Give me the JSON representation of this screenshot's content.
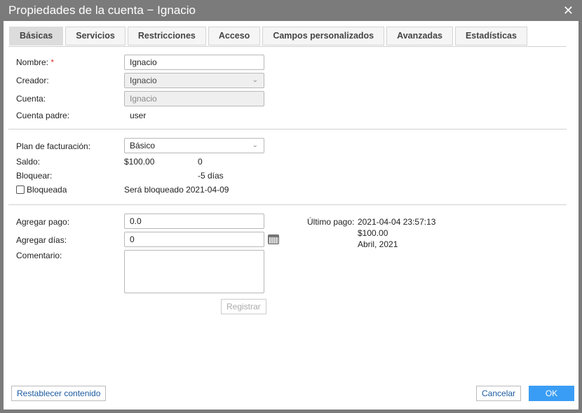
{
  "window": {
    "title": "Propiedades de la cuenta − Ignacio",
    "close": "✕"
  },
  "tabs": [
    "Básicas",
    "Servicios",
    "Restricciones",
    "Acceso",
    "Campos personalizados",
    "Avanzadas",
    "Estadísticas"
  ],
  "form": {
    "nombre_label": "Nombre:",
    "required": "*",
    "nombre_value": "Ignacio",
    "creador_label": "Creador:",
    "creador_value": "Ignacio",
    "cuenta_label": "Cuenta:",
    "cuenta_value": "Ignacio",
    "padre_label": "Cuenta padre:",
    "padre_value": "user",
    "plan_label": "Plan de facturación:",
    "plan_value": "Básico",
    "saldo_label": "Saldo:",
    "saldo_value": "$100.00",
    "saldo_days": "0",
    "bloquear_label": "Bloquear:",
    "bloquear_value": "-5 días",
    "bloqueada_label": "Bloqueada",
    "bloqueada_checked": false,
    "bloqueo_info": "Será bloqueado 2021-04-09",
    "pago_label": "Agregar pago:",
    "pago_value": "0.0",
    "dias_label": "Agregar días:",
    "dias_value": "0",
    "comentario_label": "Comentario:",
    "comentario_value": "",
    "registrar": "Registrar",
    "ultimo_label": "Último pago:",
    "ultimo_fecha": "2021-04-04 23:57:13",
    "ultimo_monto": "$100.00",
    "ultimo_mes": "Abril, 2021"
  },
  "footer": {
    "reset": "Restablecer contenido",
    "cancel": "Cancelar",
    "ok": "OK"
  }
}
